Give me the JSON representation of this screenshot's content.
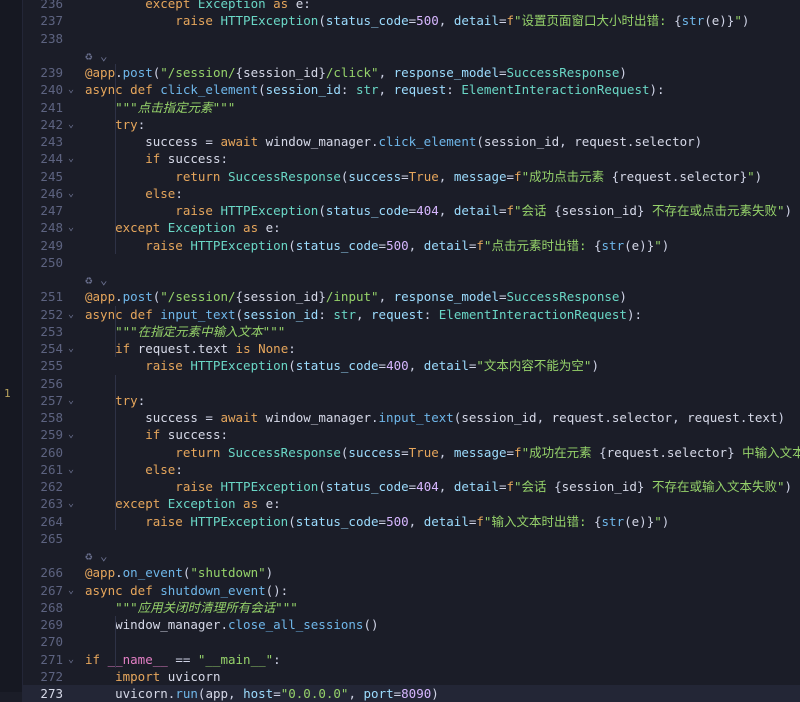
{
  "gutter_marker": "1",
  "lines": [
    {
      "n": "236",
      "code": [
        [
          "kw",
          "        except "
        ],
        [
          "cls",
          "Exception"
        ],
        [
          "kw",
          " as "
        ],
        [
          "var",
          "e"
        ],
        [
          "op",
          ":"
        ]
      ]
    },
    {
      "n": "237",
      "code": [
        [
          "kw",
          "            raise "
        ],
        [
          "cls",
          "HTTPException"
        ],
        [
          "op",
          "("
        ],
        [
          "prm",
          "status_code"
        ],
        [
          "op",
          "="
        ],
        [
          "num",
          "500"
        ],
        [
          "op",
          ", "
        ],
        [
          "prm",
          "detail"
        ],
        [
          "op",
          "="
        ],
        [
          "kw",
          "f"
        ],
        [
          "str",
          "\"设置页面窗口大小时出错: "
        ],
        [
          "op",
          "{"
        ],
        [
          "fn",
          "str"
        ],
        [
          "op",
          "("
        ],
        [
          "var",
          "e"
        ],
        [
          "op",
          ")}"
        ],
        [
          "str",
          "\""
        ],
        [
          "op",
          ")"
        ]
      ]
    },
    {
      "n": "238",
      "code": []
    },
    {
      "n": "",
      "hint": "♻ ⌄",
      "code": []
    },
    {
      "n": "239",
      "code": [
        [
          "dec",
          "@app"
        ],
        [
          "op",
          "."
        ],
        [
          "fn",
          "post"
        ],
        [
          "op",
          "("
        ],
        [
          "str",
          "\"/session/"
        ],
        [
          "op",
          "{"
        ],
        [
          "var",
          "session_id"
        ],
        [
          "op",
          "}"
        ],
        [
          "str",
          "/click\""
        ],
        [
          "op",
          ", "
        ],
        [
          "prm",
          "response_model"
        ],
        [
          "op",
          "="
        ],
        [
          "cls",
          "SuccessResponse"
        ],
        [
          "op",
          ")"
        ]
      ]
    },
    {
      "n": "240",
      "fold": "⌄",
      "code": [
        [
          "kw",
          "async def "
        ],
        [
          "fn",
          "click_element"
        ],
        [
          "op",
          "("
        ],
        [
          "prm",
          "session_id"
        ],
        [
          "op",
          ": "
        ],
        [
          "cls",
          "str"
        ],
        [
          "op",
          ", "
        ],
        [
          "prm",
          "request"
        ],
        [
          "op",
          ": "
        ],
        [
          "cls",
          "ElementInteractionRequest"
        ],
        [
          "op",
          "):"
        ]
      ]
    },
    {
      "n": "241",
      "code": [
        [
          "doc",
          "    \"\"\"点击指定元素\"\"\""
        ]
      ]
    },
    {
      "n": "242",
      "fold": "⌄",
      "code": [
        [
          "kw",
          "    try"
        ],
        [
          "op",
          ":"
        ]
      ]
    },
    {
      "n": "243",
      "code": [
        [
          "var",
          "        success "
        ],
        [
          "op",
          "= "
        ],
        [
          "kw",
          "await "
        ],
        [
          "var",
          "window_manager"
        ],
        [
          "op",
          "."
        ],
        [
          "fn",
          "click_element"
        ],
        [
          "op",
          "("
        ],
        [
          "var",
          "session_id"
        ],
        [
          "op",
          ", "
        ],
        [
          "var",
          "request"
        ],
        [
          "op",
          "."
        ],
        [
          "var",
          "selector"
        ],
        [
          "op",
          ")"
        ]
      ]
    },
    {
      "n": "244",
      "fold": "⌄",
      "code": [
        [
          "kw",
          "        if "
        ],
        [
          "var",
          "success"
        ],
        [
          "op",
          ":"
        ]
      ]
    },
    {
      "n": "245",
      "code": [
        [
          "kw",
          "            return "
        ],
        [
          "cls",
          "SuccessResponse"
        ],
        [
          "op",
          "("
        ],
        [
          "prm",
          "success"
        ],
        [
          "op",
          "="
        ],
        [
          "kw",
          "True"
        ],
        [
          "op",
          ", "
        ],
        [
          "prm",
          "message"
        ],
        [
          "op",
          "="
        ],
        [
          "kw",
          "f"
        ],
        [
          "str",
          "\"成功点击元素 "
        ],
        [
          "op",
          "{"
        ],
        [
          "var",
          "request"
        ],
        [
          "op",
          "."
        ],
        [
          "var",
          "selector"
        ],
        [
          "op",
          "}"
        ],
        [
          "str",
          "\""
        ],
        [
          "op",
          ")"
        ]
      ]
    },
    {
      "n": "246",
      "fold": "⌄",
      "code": [
        [
          "kw",
          "        else"
        ],
        [
          "op",
          ":"
        ]
      ]
    },
    {
      "n": "247",
      "code": [
        [
          "kw",
          "            raise "
        ],
        [
          "cls",
          "HTTPException"
        ],
        [
          "op",
          "("
        ],
        [
          "prm",
          "status_code"
        ],
        [
          "op",
          "="
        ],
        [
          "num",
          "404"
        ],
        [
          "op",
          ", "
        ],
        [
          "prm",
          "detail"
        ],
        [
          "op",
          "="
        ],
        [
          "kw",
          "f"
        ],
        [
          "str",
          "\"会话 "
        ],
        [
          "op",
          "{"
        ],
        [
          "var",
          "session_id"
        ],
        [
          "op",
          "}"
        ],
        [
          "str",
          " 不存在或点击元素失败\""
        ],
        [
          "op",
          ")"
        ]
      ]
    },
    {
      "n": "248",
      "fold": "⌄",
      "code": [
        [
          "kw",
          "    except "
        ],
        [
          "cls",
          "Exception"
        ],
        [
          "kw",
          " as "
        ],
        [
          "var",
          "e"
        ],
        [
          "op",
          ":"
        ]
      ]
    },
    {
      "n": "249",
      "code": [
        [
          "kw",
          "        raise "
        ],
        [
          "cls",
          "HTTPException"
        ],
        [
          "op",
          "("
        ],
        [
          "prm",
          "status_code"
        ],
        [
          "op",
          "="
        ],
        [
          "num",
          "500"
        ],
        [
          "op",
          ", "
        ],
        [
          "prm",
          "detail"
        ],
        [
          "op",
          "="
        ],
        [
          "kw",
          "f"
        ],
        [
          "str",
          "\"点击元素时出错: "
        ],
        [
          "op",
          "{"
        ],
        [
          "fn",
          "str"
        ],
        [
          "op",
          "("
        ],
        [
          "var",
          "e"
        ],
        [
          "op",
          ")}"
        ],
        [
          "str",
          "\""
        ],
        [
          "op",
          ")"
        ]
      ]
    },
    {
      "n": "250",
      "code": []
    },
    {
      "n": "",
      "hint": "♻ ⌄",
      "code": []
    },
    {
      "n": "251",
      "code": [
        [
          "dec",
          "@app"
        ],
        [
          "op",
          "."
        ],
        [
          "fn",
          "post"
        ],
        [
          "op",
          "("
        ],
        [
          "str",
          "\"/session/"
        ],
        [
          "op",
          "{"
        ],
        [
          "var",
          "session_id"
        ],
        [
          "op",
          "}"
        ],
        [
          "str",
          "/input\""
        ],
        [
          "op",
          ", "
        ],
        [
          "prm",
          "response_model"
        ],
        [
          "op",
          "="
        ],
        [
          "cls",
          "SuccessResponse"
        ],
        [
          "op",
          ")"
        ]
      ]
    },
    {
      "n": "252",
      "fold": "⌄",
      "code": [
        [
          "kw",
          "async def "
        ],
        [
          "fn",
          "input_text"
        ],
        [
          "op",
          "("
        ],
        [
          "prm",
          "session_id"
        ],
        [
          "op",
          ": "
        ],
        [
          "cls",
          "str"
        ],
        [
          "op",
          ", "
        ],
        [
          "prm",
          "request"
        ],
        [
          "op",
          ": "
        ],
        [
          "cls",
          "ElementInteractionRequest"
        ],
        [
          "op",
          "):"
        ]
      ]
    },
    {
      "n": "253",
      "code": [
        [
          "doc",
          "    \"\"\"在指定元素中输入文本\"\"\""
        ]
      ]
    },
    {
      "n": "254",
      "fold": "⌄",
      "code": [
        [
          "kw",
          "    if "
        ],
        [
          "var",
          "request"
        ],
        [
          "op",
          "."
        ],
        [
          "var",
          "text "
        ],
        [
          "kw",
          "is None"
        ],
        [
          "op",
          ":"
        ]
      ]
    },
    {
      "n": "255",
      "code": [
        [
          "kw",
          "        raise "
        ],
        [
          "cls",
          "HTTPException"
        ],
        [
          "op",
          "("
        ],
        [
          "prm",
          "status_code"
        ],
        [
          "op",
          "="
        ],
        [
          "num",
          "400"
        ],
        [
          "op",
          ", "
        ],
        [
          "prm",
          "detail"
        ],
        [
          "op",
          "="
        ],
        [
          "str",
          "\"文本内容不能为空\""
        ],
        [
          "op",
          ")"
        ]
      ]
    },
    {
      "n": "256",
      "code": []
    },
    {
      "n": "257",
      "fold": "⌄",
      "code": [
        [
          "kw",
          "    try"
        ],
        [
          "op",
          ":"
        ]
      ]
    },
    {
      "n": "258",
      "code": [
        [
          "var",
          "        success "
        ],
        [
          "op",
          "= "
        ],
        [
          "kw",
          "await "
        ],
        [
          "var",
          "window_manager"
        ],
        [
          "op",
          "."
        ],
        [
          "fn",
          "input_text"
        ],
        [
          "op",
          "("
        ],
        [
          "var",
          "session_id"
        ],
        [
          "op",
          ", "
        ],
        [
          "var",
          "request"
        ],
        [
          "op",
          "."
        ],
        [
          "var",
          "selector"
        ],
        [
          "op",
          ", "
        ],
        [
          "var",
          "request"
        ],
        [
          "op",
          "."
        ],
        [
          "var",
          "text"
        ],
        [
          "op",
          ")"
        ]
      ]
    },
    {
      "n": "259",
      "fold": "⌄",
      "code": [
        [
          "kw",
          "        if "
        ],
        [
          "var",
          "success"
        ],
        [
          "op",
          ":"
        ]
      ]
    },
    {
      "n": "260",
      "code": [
        [
          "kw",
          "            return "
        ],
        [
          "cls",
          "SuccessResponse"
        ],
        [
          "op",
          "("
        ],
        [
          "prm",
          "success"
        ],
        [
          "op",
          "="
        ],
        [
          "kw",
          "True"
        ],
        [
          "op",
          ", "
        ],
        [
          "prm",
          "message"
        ],
        [
          "op",
          "="
        ],
        [
          "kw",
          "f"
        ],
        [
          "str",
          "\"成功在元素 "
        ],
        [
          "op",
          "{"
        ],
        [
          "var",
          "request"
        ],
        [
          "op",
          "."
        ],
        [
          "var",
          "selector"
        ],
        [
          "op",
          "}"
        ],
        [
          "str",
          " 中输入文本\""
        ],
        [
          "op",
          ")"
        ]
      ]
    },
    {
      "n": "261",
      "fold": "⌄",
      "code": [
        [
          "kw",
          "        else"
        ],
        [
          "op",
          ":"
        ]
      ]
    },
    {
      "n": "262",
      "code": [
        [
          "kw",
          "            raise "
        ],
        [
          "cls",
          "HTTPException"
        ],
        [
          "op",
          "("
        ],
        [
          "prm",
          "status_code"
        ],
        [
          "op",
          "="
        ],
        [
          "num",
          "404"
        ],
        [
          "op",
          ", "
        ],
        [
          "prm",
          "detail"
        ],
        [
          "op",
          "="
        ],
        [
          "kw",
          "f"
        ],
        [
          "str",
          "\"会话 "
        ],
        [
          "op",
          "{"
        ],
        [
          "var",
          "session_id"
        ],
        [
          "op",
          "}"
        ],
        [
          "str",
          " 不存在或输入文本失败\""
        ],
        [
          "op",
          ")"
        ]
      ]
    },
    {
      "n": "263",
      "fold": "⌄",
      "code": [
        [
          "kw",
          "    except "
        ],
        [
          "cls",
          "Exception"
        ],
        [
          "kw",
          " as "
        ],
        [
          "var",
          "e"
        ],
        [
          "op",
          ":"
        ]
      ]
    },
    {
      "n": "264",
      "code": [
        [
          "kw",
          "        raise "
        ],
        [
          "cls",
          "HTTPException"
        ],
        [
          "op",
          "("
        ],
        [
          "prm",
          "status_code"
        ],
        [
          "op",
          "="
        ],
        [
          "num",
          "500"
        ],
        [
          "op",
          ", "
        ],
        [
          "prm",
          "detail"
        ],
        [
          "op",
          "="
        ],
        [
          "kw",
          "f"
        ],
        [
          "str",
          "\"输入文本时出错: "
        ],
        [
          "op",
          "{"
        ],
        [
          "fn",
          "str"
        ],
        [
          "op",
          "("
        ],
        [
          "var",
          "e"
        ],
        [
          "op",
          ")}"
        ],
        [
          "str",
          "\""
        ],
        [
          "op",
          ")"
        ]
      ]
    },
    {
      "n": "265",
      "code": []
    },
    {
      "n": "",
      "hint": "♻ ⌄",
      "code": []
    },
    {
      "n": "266",
      "code": [
        [
          "dec",
          "@app"
        ],
        [
          "op",
          "."
        ],
        [
          "fn",
          "on_event"
        ],
        [
          "op",
          "("
        ],
        [
          "str",
          "\"shutdown\""
        ],
        [
          "op",
          ")"
        ]
      ]
    },
    {
      "n": "267",
      "fold": "⌄",
      "code": [
        [
          "kw",
          "async def "
        ],
        [
          "fn",
          "shutdown_event"
        ],
        [
          "op",
          "():"
        ]
      ]
    },
    {
      "n": "268",
      "code": [
        [
          "doc",
          "    \"\"\"应用关闭时清理所有会话\"\"\""
        ]
      ]
    },
    {
      "n": "269",
      "code": [
        [
          "var",
          "    window_manager"
        ],
        [
          "op",
          "."
        ],
        [
          "fn",
          "close_all_sessions"
        ],
        [
          "op",
          "()"
        ]
      ]
    },
    {
      "n": "270",
      "code": []
    },
    {
      "n": "271",
      "fold": "⌄",
      "code": [
        [
          "kw",
          "if "
        ],
        [
          "mag",
          "__name__"
        ],
        [
          "op",
          " == "
        ],
        [
          "str",
          "\"__main__\""
        ],
        [
          "op",
          ":"
        ]
      ]
    },
    {
      "n": "272",
      "code": [
        [
          "kw",
          "    import "
        ],
        [
          "var",
          "uvicorn"
        ]
      ]
    },
    {
      "n": "273",
      "current": true,
      "code": [
        [
          "var",
          "    uvicorn"
        ],
        [
          "op",
          "."
        ],
        [
          "fn",
          "run"
        ],
        [
          "op",
          "("
        ],
        [
          "var",
          "app"
        ],
        [
          "op",
          ", "
        ],
        [
          "prm",
          "host"
        ],
        [
          "op",
          "="
        ],
        [
          "str",
          "\"0.0.0.0\""
        ],
        [
          "op",
          ", "
        ],
        [
          "prm",
          "port"
        ],
        [
          "op",
          "="
        ],
        [
          "num",
          "8090"
        ],
        [
          "op",
          ")"
        ]
      ]
    }
  ]
}
